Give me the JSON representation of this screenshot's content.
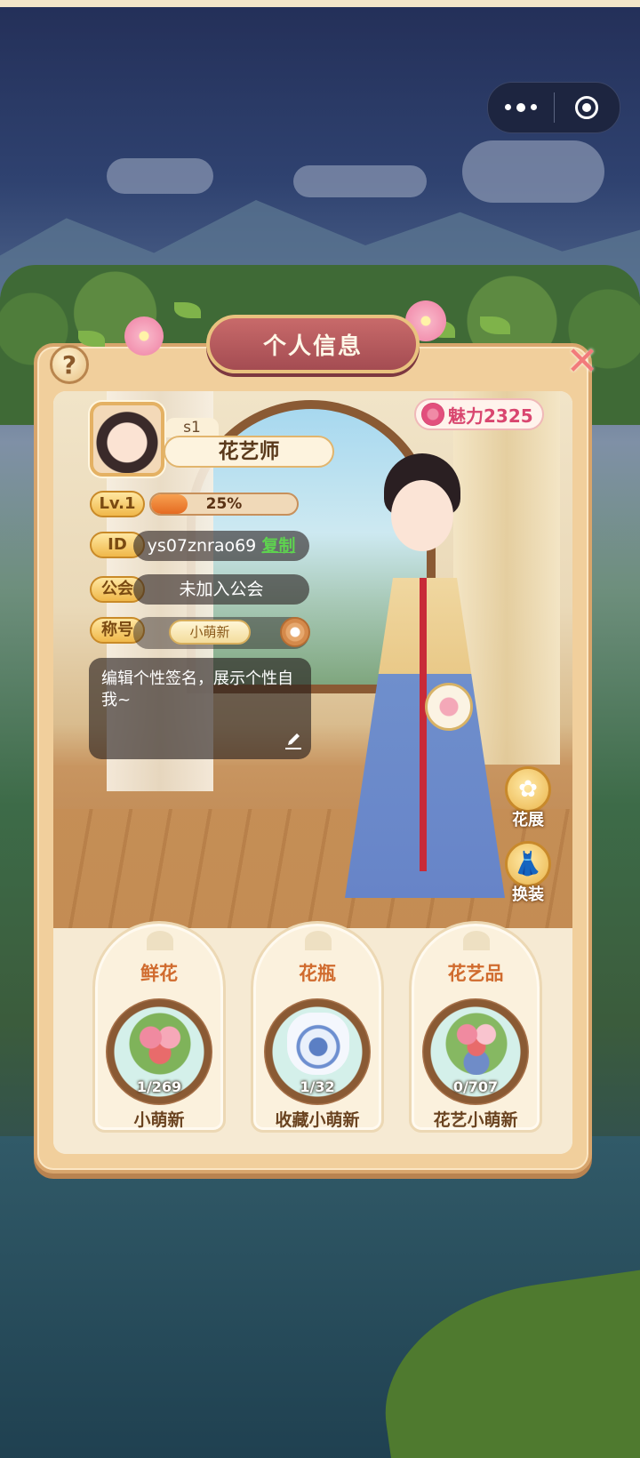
{
  "panel": {
    "title": "个人信息"
  },
  "profile": {
    "server": "s1",
    "name": "花艺师",
    "charm_label": "魅力2325",
    "level_label": "Lv.1",
    "level_progress_text": "25%",
    "level_progress": 0.25,
    "id_label": "ID",
    "id_value": "ys07znrao69",
    "copy_label": "复制",
    "guild_label": "公会",
    "guild_value": "未加入公会",
    "title_label": "称号",
    "title_value": "小萌新",
    "signature": "编辑个性签名，展示个性自我~"
  },
  "side_buttons": {
    "flower_show": "花展",
    "dress_up": "换装"
  },
  "cards": [
    {
      "title": "鲜花",
      "count": "1/269",
      "name": "小萌新"
    },
    {
      "title": "花瓶",
      "count": "1/32",
      "name": "收藏小萌新"
    },
    {
      "title": "花艺品",
      "count": "0/707",
      "name": "花艺小萌新"
    }
  ],
  "colors": {
    "accent": "#d06b2e",
    "charm": "#d9466f",
    "copy": "#5ed34f"
  }
}
